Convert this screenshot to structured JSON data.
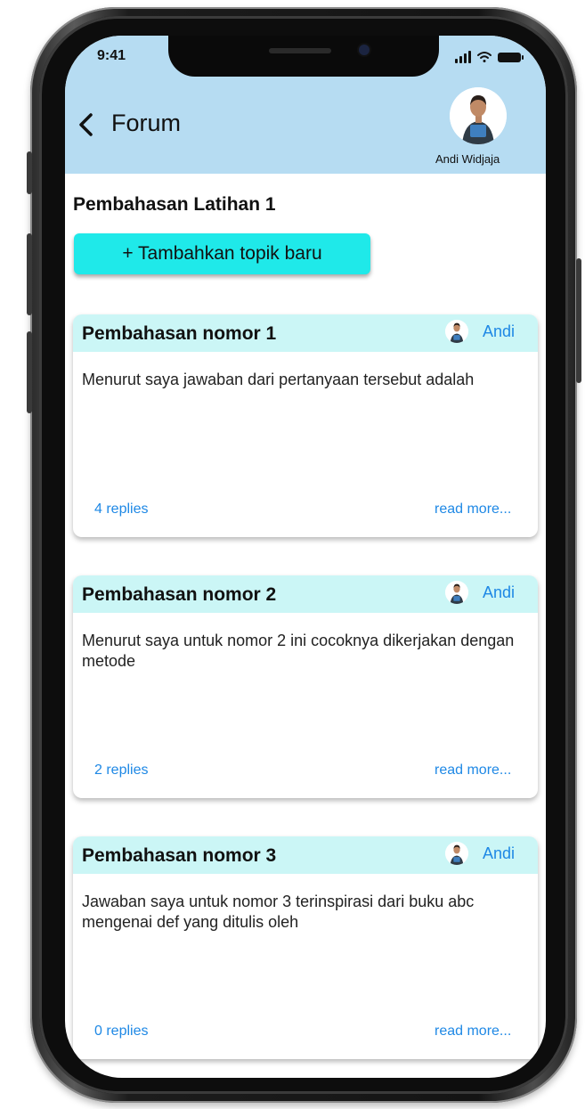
{
  "status_bar": {
    "time": "9:41"
  },
  "header": {
    "back_icon": "chevron-left-icon",
    "title": "Forum",
    "user_name": "Andi Widjaja"
  },
  "section": {
    "title": "Pembahasan Latihan 1",
    "add_button_label": "+ Tambahkan topik baru"
  },
  "topics": [
    {
      "title": "Pembahasan nomor 1",
      "author": "Andi",
      "body": "Menurut saya jawaban dari pertanyaan tersebut adalah",
      "replies": "4 replies",
      "read_more": "read more..."
    },
    {
      "title": "Pembahasan nomor 2",
      "author": "Andi",
      "body": "Menurut saya untuk nomor 2 ini cocoknya dikerjakan dengan metode",
      "replies": "2 replies",
      "read_more": "read more..."
    },
    {
      "title": "Pembahasan nomor 3",
      "author": "Andi",
      "body": "Jawaban saya untuk nomor 3 terinspirasi dari buku abc mengenai def yang ditulis oleh",
      "replies": "0 replies",
      "read_more": "read more..."
    }
  ],
  "colors": {
    "header_bg": "#b6dcf2",
    "button_bg": "#1fe9e9",
    "card_header_bg": "#cbf6f6",
    "link": "#1e88e5"
  }
}
